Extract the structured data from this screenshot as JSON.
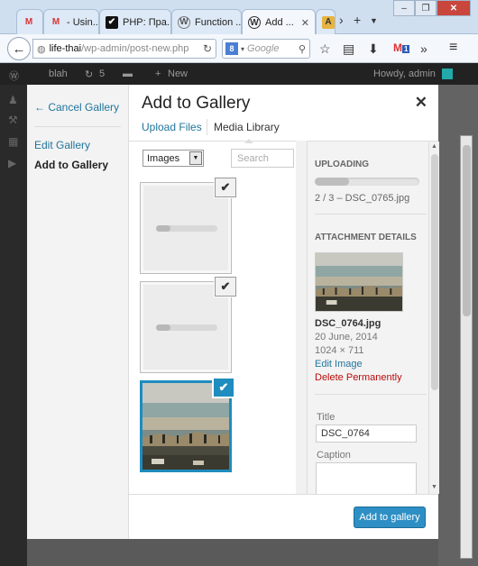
{
  "browser": {
    "tabs": [
      {
        "label": "- Usin...",
        "icon": "gmail-icon"
      },
      {
        "label": "PHP: Пра...",
        "icon": "php-icon"
      },
      {
        "label": "Function ...",
        "icon": "wordpress-icon"
      },
      {
        "label": "Add ...",
        "icon": "wordpress-icon",
        "active": true
      }
    ],
    "gmail_count": "1",
    "url_host": "life-thai",
    "url_path": "/wp-admin/post-new.php",
    "search_engine": "8",
    "search_placeholder": "Google"
  },
  "wp_admin_bar": {
    "site": "blah",
    "updates": "5",
    "new_label": "New",
    "howdy": "Howdy, admin"
  },
  "modal": {
    "title": "Add to Gallery",
    "menu": {
      "cancel_label": "← Cancel Gallery",
      "items": [
        "Edit Gallery",
        "Add to Gallery"
      ]
    },
    "router_tabs": [
      "Upload Files",
      "Media Library"
    ],
    "filter": {
      "selected": "Images"
    },
    "search_placeholder": "Search",
    "attachments": [
      {
        "state": "uploading",
        "progress": 0.24,
        "checked": true
      },
      {
        "state": "uploading",
        "progress": 0.24,
        "checked": true
      },
      {
        "state": "image",
        "checked": true,
        "selected": true,
        "name": "DSC_0764.jpg"
      }
    ],
    "sidebar": {
      "uploading_heading": "UPLOADING",
      "upload_progress": 0.33,
      "upload_status": "2 / 3  –  DSC_0765.jpg",
      "details_heading": "ATTACHMENT DETAILS",
      "filename": "DSC_0764.jpg",
      "date": "20 June, 2014",
      "dimensions": "1024 × 711",
      "edit_label": "Edit Image",
      "delete_label": "Delete Permanently",
      "title_label": "Title",
      "title_value": "DSC_0764",
      "caption_label": "Caption"
    },
    "primary_button": "Add to gallery",
    "colors": {
      "accent": "#1e8cbe",
      "link": "#21759b",
      "delete": "#bc0b0b",
      "button": "#2e8fc4"
    }
  }
}
